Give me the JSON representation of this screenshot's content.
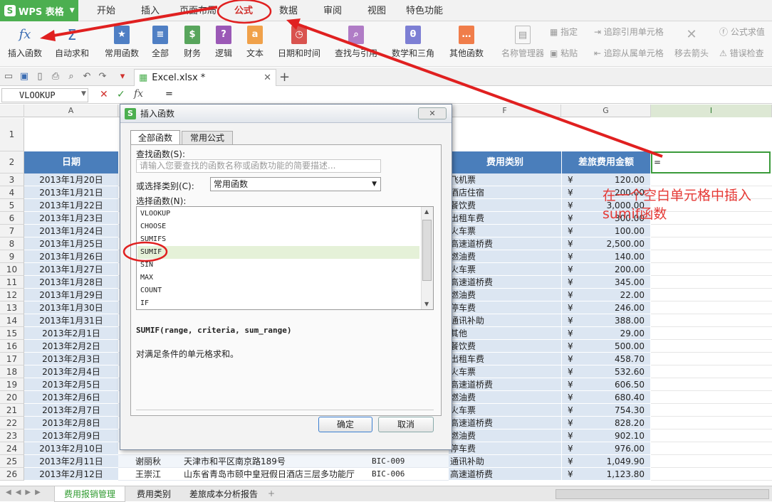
{
  "app": {
    "name": "WPS 表格"
  },
  "menu": {
    "tabs": [
      "开始",
      "插入",
      "页面布局",
      "公式",
      "数据",
      "审阅",
      "视图",
      "特色功能"
    ]
  },
  "ribbon": {
    "buttons": [
      "插入函数",
      "自动求和",
      "常用函数",
      "全部",
      "财务",
      "逻辑",
      "文本",
      "日期和时间",
      "查找与引用",
      "数学和三角",
      "其他函数"
    ],
    "name_manager": "名称管理器",
    "assign": "指定",
    "paste": "粘贴",
    "trace_precedents": "追踪引用单元格",
    "trace_dependents": "追踪从属单元格",
    "remove_arrows": "移去箭头",
    "formula_eval": "公式求值",
    "error_check": "错误检查"
  },
  "file_tab": {
    "name": "Excel.xlsx *"
  },
  "formula_bar": {
    "name_box": "VLOOKUP",
    "content": "="
  },
  "columns": [
    "A",
    "F",
    "G",
    "I"
  ],
  "table": {
    "header_date": "日期",
    "header_category": "费用类别",
    "header_amount": "差旅费用金额",
    "active_cell_value": "=",
    "rows": [
      {
        "n": "3",
        "date": "2013年1月20日",
        "cat": "飞机票",
        "amt": "120.00"
      },
      {
        "n": "4",
        "date": "2013年1月21日",
        "cat": "酒店住宿",
        "amt": "200.00"
      },
      {
        "n": "5",
        "date": "2013年1月22日",
        "cat": "餐饮费",
        "amt": "3,000.00"
      },
      {
        "n": "6",
        "date": "2013年1月23日",
        "cat": "出租车费",
        "amt": "300.00"
      },
      {
        "n": "7",
        "date": "2013年1月24日",
        "cat": "火车票",
        "amt": "100.00"
      },
      {
        "n": "8",
        "date": "2013年1月25日",
        "cat": "高速道桥费",
        "amt": "2,500.00"
      },
      {
        "n": "9",
        "date": "2013年1月26日",
        "cat": "燃油费",
        "amt": "140.00"
      },
      {
        "n": "10",
        "date": "2013年1月27日",
        "cat": "火车票",
        "amt": "200.00"
      },
      {
        "n": "11",
        "date": "2013年1月28日",
        "cat": "高速道桥费",
        "amt": "345.00"
      },
      {
        "n": "12",
        "date": "2013年1月29日",
        "cat": "燃油费",
        "amt": "22.00"
      },
      {
        "n": "13",
        "date": "2013年1月30日",
        "cat": "停车费",
        "amt": "246.00"
      },
      {
        "n": "14",
        "date": "2013年1月31日",
        "cat": "通讯补助",
        "amt": "388.00"
      },
      {
        "n": "15",
        "date": "2013年2月1日",
        "cat": "其他",
        "amt": "29.00"
      },
      {
        "n": "16",
        "date": "2013年2月2日",
        "cat": "餐饮费",
        "amt": "500.00"
      },
      {
        "n": "17",
        "date": "2013年2月3日",
        "cat": "出租车费",
        "amt": "458.70"
      },
      {
        "n": "18",
        "date": "2013年2月4日",
        "cat": "火车票",
        "amt": "532.60"
      },
      {
        "n": "19",
        "date": "2013年2月5日",
        "cat": "高速道桥费",
        "amt": "606.50"
      },
      {
        "n": "20",
        "date": "2013年2月6日",
        "cat": "燃油费",
        "amt": "680.40"
      },
      {
        "n": "21",
        "date": "2013年2月7日",
        "cat": "火车票",
        "amt": "754.30"
      },
      {
        "n": "22",
        "date": "2013年2月8日",
        "cat": "高速道桥费",
        "amt": "828.20"
      },
      {
        "n": "23",
        "date": "2013年2月9日",
        "cat": "燃油费",
        "amt": "902.10"
      },
      {
        "n": "24",
        "date": "2013年2月10日",
        "cat": "停车费",
        "amt": "976.00"
      },
      {
        "n": "25",
        "date": "2013年2月11日",
        "cat": "通讯补助",
        "amt": "1,049.90"
      },
      {
        "n": "26",
        "date": "2013年2月12日",
        "cat": "高速道桥费",
        "amt": "1,123.80"
      }
    ],
    "row25_name": "谢丽秋",
    "row25_addr": "天津市和平区南京路189号",
    "row25_code": "BIC-009",
    "row26_name": "王崇江",
    "row26_addr": "山东省青岛市颐中皇冠假日酒店三层多功能厅",
    "row26_code": "BIC-006",
    "currency": "¥"
  },
  "dialog": {
    "title": "插入函数",
    "tab_all": "全部函数",
    "tab_common": "常用公式",
    "search_label": "查找函数(S):",
    "search_placeholder": "请输入您要查找的函数名称或函数功能的简要描述...",
    "category_label": "或选择类别(C):",
    "category_value": "常用函数",
    "select_label": "选择函数(N):",
    "functions": [
      "VLOOKUP",
      "CHOOSE",
      "SUMIFS",
      "SUMIF",
      "SIN",
      "MAX",
      "COUNT",
      "IF"
    ],
    "selected_function": "SUMIF",
    "signature": "SUMIF(range, criteria, sum_range)",
    "description": "对满足条件的单元格求和。",
    "ok": "确定",
    "cancel": "取消"
  },
  "sheet_tabs": [
    "费用报销管理",
    "费用类别",
    "差旅成本分析报告"
  ],
  "annotation": {
    "text": "在一个空白单元格中插入sumif函数"
  }
}
